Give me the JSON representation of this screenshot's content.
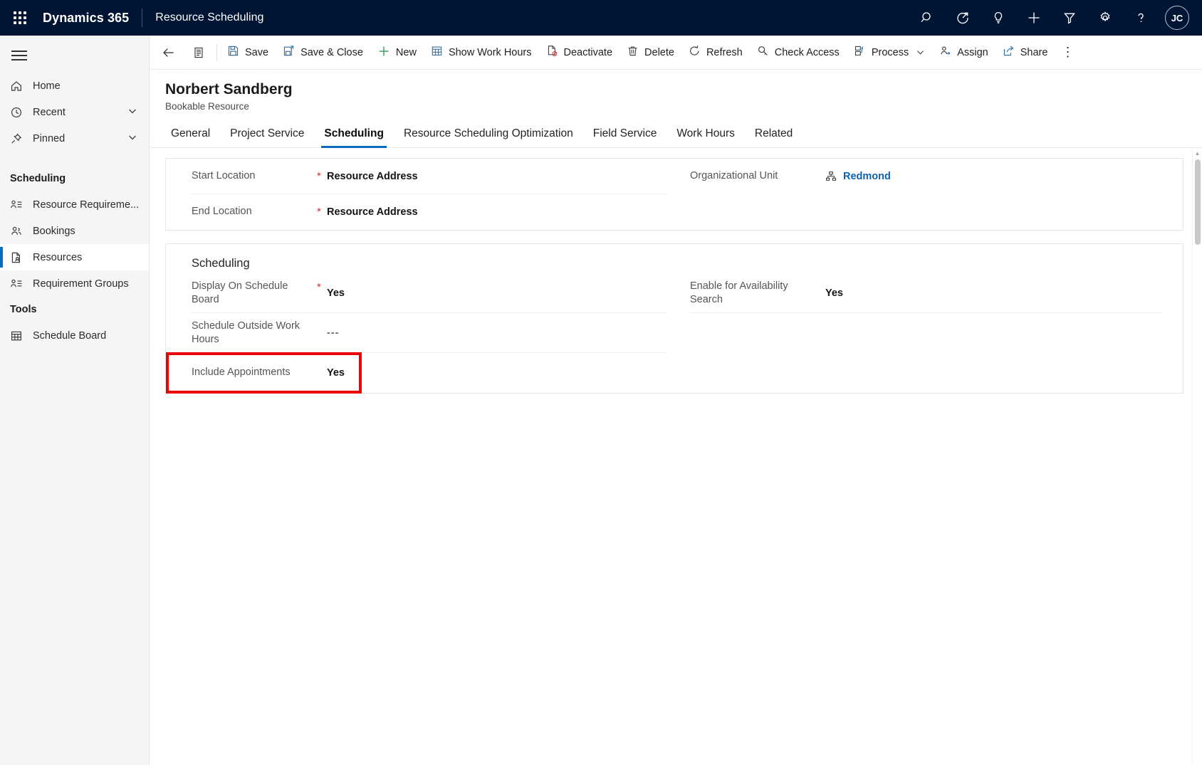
{
  "topnav": {
    "waffle_label": "app-launcher",
    "brand": "Dynamics 365",
    "app_area": "Resource Scheduling",
    "icons": [
      {
        "name": "search-icon",
        "label": "Search"
      },
      {
        "name": "diagnostics-icon",
        "label": "Diagnostics"
      },
      {
        "name": "lightbulb-icon",
        "label": "Insights"
      },
      {
        "name": "plus-icon",
        "label": "Quick create"
      },
      {
        "name": "filter-icon",
        "label": "Filter"
      },
      {
        "name": "gear-icon",
        "label": "Settings"
      },
      {
        "name": "help-icon",
        "label": "Help"
      }
    ],
    "avatar_initials": "JC",
    "background": "#001433"
  },
  "sidebar": {
    "hamburger_label": "Expand or collapse navigation",
    "items": [
      {
        "label": "Home",
        "icon": "home-icon",
        "chevron": false,
        "selected": false
      },
      {
        "label": "Recent",
        "icon": "clock-icon",
        "chevron": true,
        "selected": false
      },
      {
        "label": "Pinned",
        "icon": "pin-icon",
        "chevron": true,
        "selected": false
      }
    ],
    "groups": [
      {
        "title": "Scheduling",
        "items": [
          {
            "label": "Resource Requireme...",
            "icon": "person-list-icon",
            "selected": false
          },
          {
            "label": "Bookings",
            "icon": "people-icon",
            "selected": false
          },
          {
            "label": "Resources",
            "icon": "resource-icon",
            "selected": true
          },
          {
            "label": "Requirement Groups",
            "icon": "person-list-icon",
            "selected": false
          }
        ]
      },
      {
        "title": "Tools",
        "items": [
          {
            "label": "Schedule Board",
            "icon": "calendar-icon",
            "selected": false
          }
        ]
      }
    ],
    "accent": "#0b6cbf"
  },
  "commandbar": {
    "back_label": "Back",
    "form_selector_label": "Form selector",
    "buttons": [
      {
        "label": "Save",
        "icon": "save-icon"
      },
      {
        "label": "Save & Close",
        "icon": "save-close-icon"
      },
      {
        "label": "New",
        "icon": "plus-icon"
      },
      {
        "label": "Show Work Hours",
        "icon": "calendar-icon"
      },
      {
        "label": "Deactivate",
        "icon": "deactivate-icon"
      },
      {
        "label": "Delete",
        "icon": "trash-icon"
      },
      {
        "label": "Refresh",
        "icon": "refresh-icon"
      },
      {
        "label": "Check Access",
        "icon": "key-icon"
      },
      {
        "label": "Process",
        "icon": "process-icon",
        "chevron": true
      },
      {
        "label": "Assign",
        "icon": "assign-icon"
      },
      {
        "label": "Share",
        "icon": "share-icon"
      }
    ],
    "overflow_label": "More commands"
  },
  "record": {
    "title": "Norbert Sandberg",
    "subtitle": "Bookable Resource"
  },
  "tabs": [
    {
      "label": "General",
      "active": false
    },
    {
      "label": "Project Service",
      "active": false
    },
    {
      "label": "Scheduling",
      "active": true
    },
    {
      "label": "Resource Scheduling Optimization",
      "active": false
    },
    {
      "label": "Field Service",
      "active": false
    },
    {
      "label": "Work Hours",
      "active": false
    },
    {
      "label": "Related",
      "active": false
    }
  ],
  "section_location": {
    "left_fields": [
      {
        "label": "Start Location",
        "required": true,
        "value": "Resource Address",
        "type": "text"
      },
      {
        "label": "End Location",
        "required": true,
        "value": "Resource Address",
        "type": "text"
      }
    ],
    "right_fields": [
      {
        "label": "Organizational Unit",
        "required": false,
        "value": "Redmond",
        "type": "link",
        "icon": "org-unit-icon"
      }
    ]
  },
  "section_scheduling": {
    "title": "Scheduling",
    "left_fields": [
      {
        "label": "Display On Schedule Board",
        "required": true,
        "value": "Yes",
        "type": "text"
      },
      {
        "label": "Schedule Outside Work Hours",
        "required": false,
        "value": "---",
        "type": "muted"
      },
      {
        "label": "Include Appointments",
        "required": false,
        "value": "Yes",
        "type": "text",
        "highlighted": true
      }
    ],
    "right_fields": [
      {
        "label": "Enable for Availability Search",
        "required": false,
        "value": "Yes",
        "type": "text"
      }
    ]
  },
  "highlight": {
    "color": "#ee0000",
    "target": "Include Appointments"
  }
}
